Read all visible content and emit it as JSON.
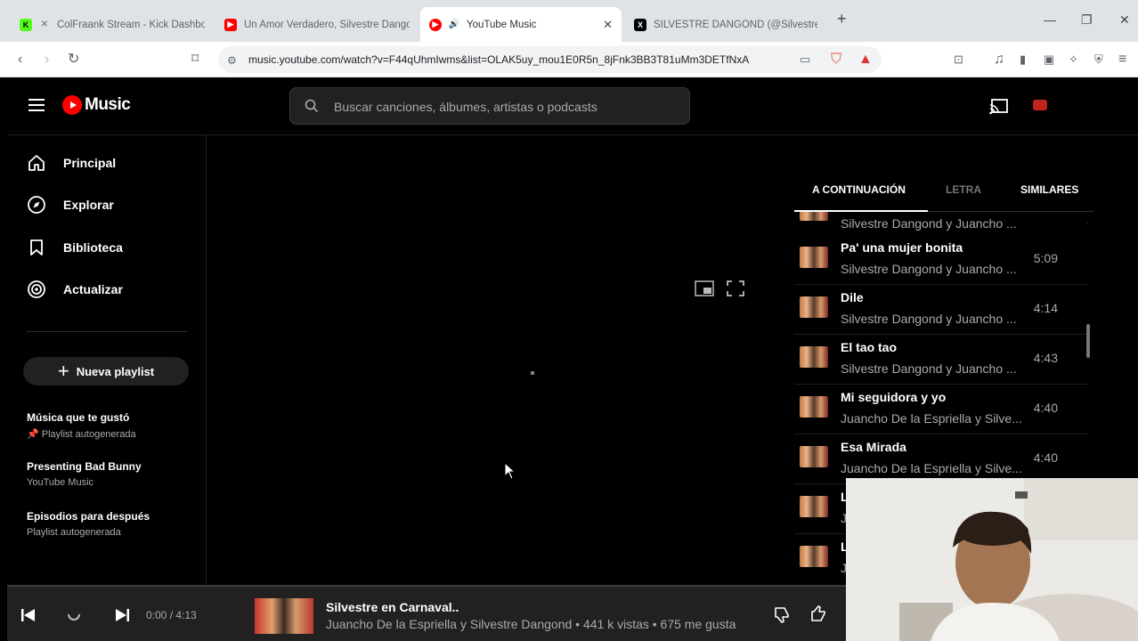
{
  "browser": {
    "tabs": [
      {
        "title": "ColFraank Stream - Kick Dashboa",
        "active": false
      },
      {
        "title": "Un Amor Verdadero, Silvestre Dango",
        "active": false
      },
      {
        "title": "YouTube Music",
        "active": true
      },
      {
        "title": "SILVESTRE DANGOND (@SilvestreFD",
        "active": false
      }
    ],
    "new_tab": "+",
    "url": "music.youtube.com/watch?v=F44qUhmIwms&list=OLAK5uy_mou1E0R5n_8jFnk3BB3T81uMm3DETfNxA"
  },
  "app": {
    "logo_text": "Music",
    "search_placeholder": "Buscar canciones, álbumes, artistas o podcasts",
    "nav": [
      {
        "label": "Principal",
        "icon": "home-icon"
      },
      {
        "label": "Explorar",
        "icon": "compass-icon"
      },
      {
        "label": "Biblioteca",
        "icon": "library-icon"
      },
      {
        "label": "Actualizar",
        "icon": "upgrade-icon"
      }
    ],
    "new_playlist": "Nueva playlist",
    "playlists": [
      {
        "title": "Música que te gustó",
        "subtitle": "Playlist autogenerada"
      },
      {
        "title": "Presenting Bad Bunny",
        "subtitle": "YouTube Music"
      },
      {
        "title": "Episodios para después",
        "subtitle": "Playlist autogenerada"
      }
    ]
  },
  "queue": {
    "tabs": [
      "A CONTINUACIÓN",
      "LETRA",
      "SIMILARES"
    ],
    "partial_artist": "Silvestre Dangond y Juancho ...",
    "items": [
      {
        "title": "Pa' una mujer bonita",
        "artist": "Silvestre Dangond y Juancho ...",
        "duration": "5:09"
      },
      {
        "title": "Dile",
        "artist": "Silvestre Dangond y Juancho ...",
        "duration": "4:14"
      },
      {
        "title": "El tao tao",
        "artist": "Silvestre Dangond y Juancho ...",
        "duration": "4:43"
      },
      {
        "title": "Mi seguidora y yo",
        "artist": "Juancho De la Espriella y Silve...",
        "duration": "4:40"
      },
      {
        "title": "Esa Mirada",
        "artist": "Juancho De la Espriella y Silve...",
        "duration": "4:40"
      },
      {
        "title": "L",
        "artist": "J",
        "duration": ""
      },
      {
        "title": "L",
        "artist": "J",
        "duration": ""
      }
    ]
  },
  "now_playing": {
    "time": "0:00 / 4:13",
    "title": "Silvestre en Carnaval..",
    "subtitle": "Juancho De la Espriella y Silvestre Dangond • 441 k vistas • 675 me gusta",
    "progress_fraction": 0
  }
}
